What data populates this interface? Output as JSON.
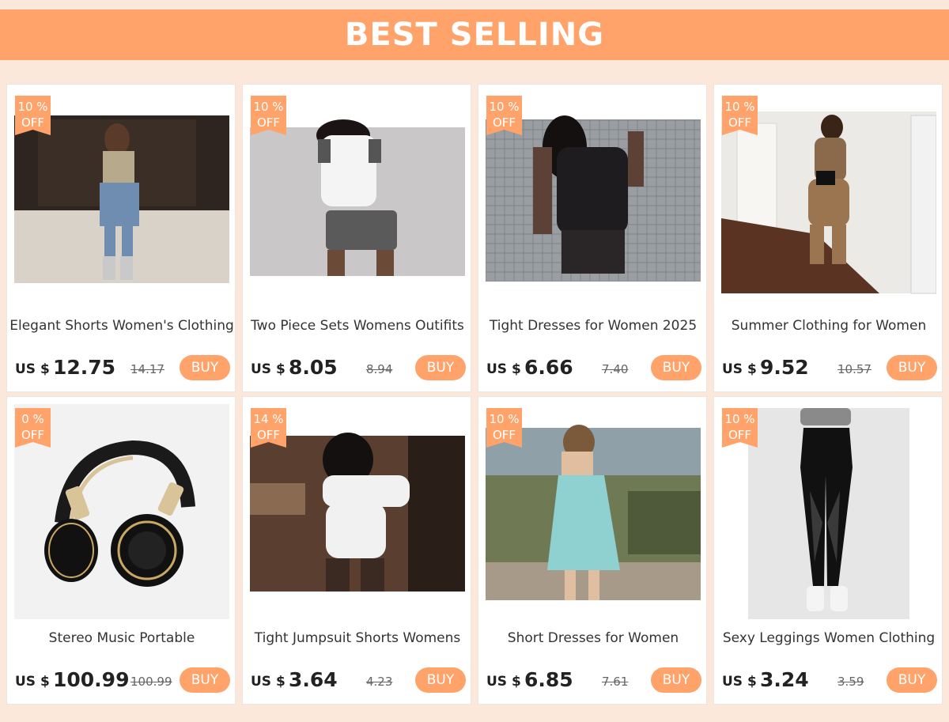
{
  "banner": {
    "title": "BEST SELLING"
  },
  "products": [
    {
      "badge_pct": "10 %",
      "badge_off": "OFF",
      "title": "Elegant Shorts Women's Clothing",
      "currency": "US $",
      "price": "12.75",
      "old_price": "14.17",
      "buy_label": "BUY"
    },
    {
      "badge_pct": "10 %",
      "badge_off": "OFF",
      "title": "Two Piece Sets Womens Outifits",
      "currency": "US $",
      "price": "8.05",
      "old_price": "8.94",
      "buy_label": "BUY"
    },
    {
      "badge_pct": "10 %",
      "badge_off": "OFF",
      "title": "Tight Dresses for Women 2025",
      "currency": "US $",
      "price": "6.66",
      "old_price": "7.40",
      "buy_label": "BUY"
    },
    {
      "badge_pct": "10 %",
      "badge_off": "OFF",
      "title": "Summer Clothing for Women",
      "currency": "US $",
      "price": "9.52",
      "old_price": "10.57",
      "buy_label": "BUY"
    },
    {
      "badge_pct": "0 %",
      "badge_off": "OFF",
      "title": "Stereo Music Portable",
      "currency": "US $",
      "price": "100.99",
      "old_price": "100.99",
      "buy_label": "BUY"
    },
    {
      "badge_pct": "14 %",
      "badge_off": "OFF",
      "title": "Tight Jumpsuit Shorts Womens",
      "currency": "US $",
      "price": "3.64",
      "old_price": "4.23",
      "buy_label": "BUY"
    },
    {
      "badge_pct": "10 %",
      "badge_off": "OFF",
      "title": "Short Dresses for Women",
      "currency": "US $",
      "price": "6.85",
      "old_price": "7.61",
      "buy_label": "BUY"
    },
    {
      "badge_pct": "10 %",
      "badge_off": "OFF",
      "title": "Sexy Leggings Women Clothing",
      "currency": "US $",
      "price": "3.24",
      "old_price": "3.59",
      "buy_label": "BUY"
    }
  ]
}
